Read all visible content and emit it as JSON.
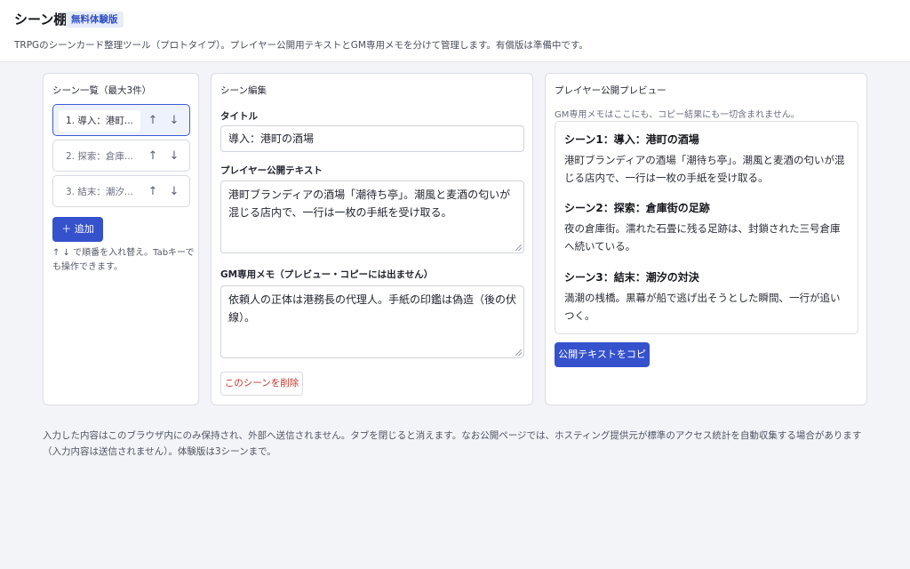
{
  "app": {
    "title": "シーン棚",
    "badge": "無料体験版",
    "description": "TRPGのシーンカード整理ツール（プロトタイプ）。プレイヤー公開用テキストとGM専用メモを分けて管理します。有償版は準備中です。"
  },
  "scene_list": {
    "title": "シーン一覧（最大3件）",
    "items": [
      {
        "label": "1. 導入：港町...",
        "selected": true
      },
      {
        "label": "2. 探索：倉庫...",
        "selected": false
      },
      {
        "label": "3. 結末：潮汐...",
        "selected": false
      }
    ],
    "up_arrow": "↑",
    "down_arrow": "↓",
    "add_button": "＋ 追加",
    "hint": "↑ ↓ で順番を入れ替え。Tabキーでも操作できます。"
  },
  "editor": {
    "title": "シーン編集",
    "title_label": "タイトル",
    "title_value": "導入：港町の酒場",
    "public_label": "プレイヤー公開テキスト",
    "public_value": "港町ブランディアの酒場「潮待ち亭」。潮風と麦酒の匂いが混じる店内で、一行は一枚の手紙を受け取る。",
    "gm_label": "GM専用メモ（プレビュー・コピーには出ません）",
    "gm_value": "依頼人の正体は港務長の代理人。手紙の印鑑は偽造（後の伏線）。",
    "delete_button": "このシーンを削除"
  },
  "preview": {
    "title": "プレイヤー公開プレビュー",
    "note": "GM専用メモはここにも、コピー結果にも一切含まれません。",
    "scenes": [
      {
        "heading": "シーン1：導入：港町の酒場",
        "body": "港町ブランディアの酒場「潮待ち亭」。潮風と麦酒の匂いが混じる店内で、一行は一枚の手紙を受け取る。"
      },
      {
        "heading": "シーン2：探索：倉庫街の足跡",
        "body": "夜の倉庫街。濡れた石畳に残る足跡は、封鎖された三号倉庫へ続いている。"
      },
      {
        "heading": "シーン3：結末：潮汐の対決",
        "body": "満潮の桟橋。黒幕が船で逃げ出そうとした瞬間、一行が追いつく。"
      }
    ],
    "copy_button": "公開テキストをコピー"
  },
  "footer": {
    "note": "入力した内容はこのブラウザ内にのみ保持され、外部へ送信されません。タブを閉じると消えます。なお公開ページでは、ホスティング提供元が標準のアクセス統計を自動収集する場合があります（入力内容は送信されません）。体験版は3シーンまで。"
  },
  "colors": {
    "accent": "#3552cc",
    "danger": "#c2362b",
    "badge_bg": "#e6ecfb"
  }
}
